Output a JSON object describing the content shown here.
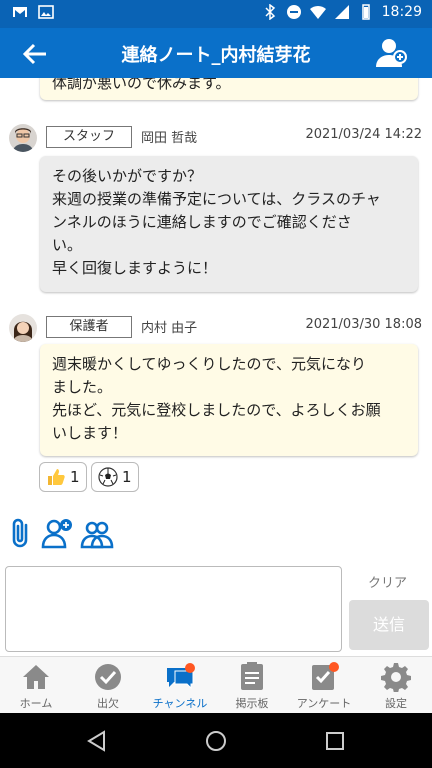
{
  "status_bar": {
    "time": "18:29"
  },
  "header": {
    "title": "連絡ノート_内村結芽花"
  },
  "messages": [
    {
      "text_lines": [
        "体調が悪いので休みます。"
      ]
    },
    {
      "role": "スタッフ",
      "sender": "岡田 哲哉",
      "timestamp": "2021/03/24 14:22",
      "text_lines": [
        "その後いかがですか？",
        "来週の授業の準備予定については、クラスのチャ",
        "ンネルのほうに連絡しますのでご確認くださ",
        "い。",
        "早く回復しますように！"
      ]
    },
    {
      "role": "保護者",
      "sender": "内村 由子",
      "timestamp": "2021/03/30 18:08",
      "text_lines": [
        "週末暖かくしてゆっくりしたので、元気になり",
        "ました。",
        "先ほど、元気に登校しましたので、よろしくお願",
        "いします！"
      ]
    }
  ],
  "reactions": [
    {
      "icon": "thumbs-up-icon",
      "count": "1"
    },
    {
      "icon": "soccer-ball-icon",
      "count": "1"
    }
  ],
  "composer": {
    "clear_label": "クリア",
    "send_label": "送信"
  },
  "tabs": [
    {
      "label": "ホーム",
      "icon": "home-icon"
    },
    {
      "label": "出欠",
      "icon": "check-circle-icon"
    },
    {
      "label": "チャンネル",
      "icon": "chat-icon",
      "active": true
    },
    {
      "label": "掲示板",
      "icon": "board-icon"
    },
    {
      "label": "アンケート",
      "icon": "survey-icon"
    },
    {
      "label": "設定",
      "icon": "gear-icon"
    }
  ],
  "colors": {
    "primary": "#0a70c9",
    "status_bar": "#0a63b5",
    "badge": "#ff5722",
    "bubble_parent": "#fffbe6",
    "bubble_staff": "#ececec"
  }
}
